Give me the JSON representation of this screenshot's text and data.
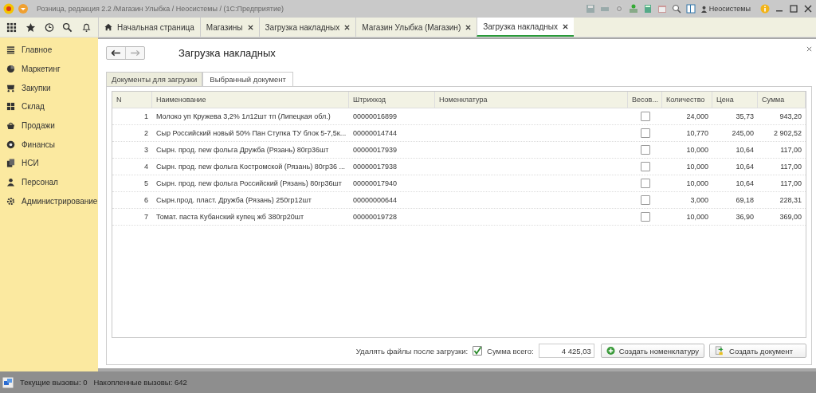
{
  "window": {
    "title": "Розница, редакция 2.2 /Магазин Улыбка / Неосистемы /  (1С:Предприятие)",
    "user": "Неосистемы"
  },
  "sections": [
    {
      "label": "Главное"
    },
    {
      "label": "Маркетинг"
    },
    {
      "label": "Закупки"
    },
    {
      "label": "Склад"
    },
    {
      "label": "Продажи"
    },
    {
      "label": "Финансы"
    },
    {
      "label": "НСИ"
    },
    {
      "label": "Персонал"
    },
    {
      "label": "Администрирование"
    }
  ],
  "open_tabs": [
    {
      "kind": "home",
      "label": "Начальная страница",
      "selected": false
    },
    {
      "kind": "tab",
      "label": "Магазины",
      "selected": false
    },
    {
      "kind": "tab",
      "label": "Загрузка накладных",
      "selected": false
    },
    {
      "kind": "tab",
      "label": "Магазин Улыбка (Магазин)",
      "selected": false
    },
    {
      "kind": "tab",
      "label": "Загрузка накладных",
      "selected": true
    }
  ],
  "form": {
    "title": "Загрузка накладных",
    "subtabs": [
      {
        "label": "Документы для загрузки",
        "selected": false
      },
      {
        "label": "Выбранный документ",
        "selected": true
      }
    ],
    "table": {
      "columns": [
        "N",
        "Наименование",
        "Штрихкод",
        "Номенклатура",
        "Весов...",
        "Количество",
        "Цена",
        "Сумма"
      ],
      "rows": [
        {
          "n": "1",
          "name": "Молоко уп Кружева 3,2% 1л12шт тп (Липецкая обл.)",
          "barcode": "00000016899",
          "weighted": false,
          "qty": "24,000",
          "price": "35,73",
          "sum": "943,20"
        },
        {
          "n": "2",
          "name": "Сыр Российский новый 50% Пан Ступка ТУ блок 5-7,5к...",
          "barcode": "00000014744",
          "weighted": false,
          "qty": "10,770",
          "price": "245,00",
          "sum": "2 902,52"
        },
        {
          "n": "3",
          "name": "Сырн. прод. new фольга Дружба (Рязань) 80гр36шт",
          "barcode": "00000017939",
          "weighted": false,
          "qty": "10,000",
          "price": "10,64",
          "sum": "117,00"
        },
        {
          "n": "4",
          "name": "Сырн. прод. new фольга Костромской (Рязань) 80гр36 ...",
          "barcode": "00000017938",
          "weighted": false,
          "qty": "10,000",
          "price": "10,64",
          "sum": "117,00"
        },
        {
          "n": "5",
          "name": "Сырн. прод. new фольга Российский (Рязань) 80гр36шт",
          "barcode": "00000017940",
          "weighted": false,
          "qty": "10,000",
          "price": "10,64",
          "sum": "117,00"
        },
        {
          "n": "6",
          "name": "Сырн.прод.  пласт. Дружба (Рязань) 250гр12шт",
          "barcode": "00000000644",
          "weighted": false,
          "qty": "3,000",
          "price": "69,18",
          "sum": "228,31"
        },
        {
          "n": "7",
          "name": "Томат. паста Кубанский купец жб 380гр20шт",
          "barcode": "00000019728",
          "weighted": false,
          "qty": "10,000",
          "price": "36,90",
          "sum": "369,00"
        }
      ]
    },
    "footer": {
      "delete_files_label": "Удалять файлы после загрузки:",
      "delete_files_checked": true,
      "total_label": "Сумма всего:",
      "total_value": "4 425,03",
      "buttons": [
        {
          "kind": "add",
          "label": "Создать номенклатуру"
        },
        {
          "kind": "doc",
          "label": "Создать документ"
        }
      ]
    }
  },
  "status_bar": {
    "current_calls": "Текущие вызовы: 0",
    "accumulated_calls": "Накопленные вызовы: 642"
  }
}
